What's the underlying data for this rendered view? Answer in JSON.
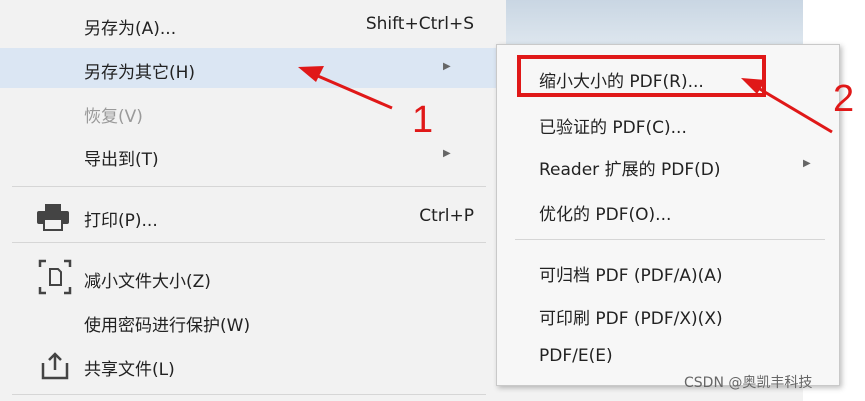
{
  "menu": {
    "save_as": {
      "label": "另存为(A)...",
      "shortcut": "Shift+Ctrl+S"
    },
    "save_as_other": {
      "label": "另存为其它(H)"
    },
    "revert": {
      "label": "恢复(V)"
    },
    "export_to": {
      "label": "导出到(T)"
    },
    "print": {
      "label": "打印(P)...",
      "shortcut": "Ctrl+P"
    },
    "reduce_size": {
      "label": "减小文件大小(Z)"
    },
    "protect_password": {
      "label": "使用密码进行保护(W)"
    },
    "share_file": {
      "label": "共享文件(L)"
    }
  },
  "submenu": {
    "items": [
      {
        "label": "缩小大小的 PDF(R)..."
      },
      {
        "label": "已验证的 PDF(C)..."
      },
      {
        "label": "Reader 扩展的 PDF(D)"
      },
      {
        "label": "优化的 PDF(O)..."
      },
      {
        "label": "可归档 PDF (PDF/A)(A)"
      },
      {
        "label": "可印刷 PDF (PDF/X)(X)"
      },
      {
        "label": "PDF/E(E)"
      }
    ]
  },
  "annotations": {
    "step1": "1",
    "step2": "2",
    "color": "#e01818"
  },
  "watermark": "CSDN @奥凯丰科技"
}
